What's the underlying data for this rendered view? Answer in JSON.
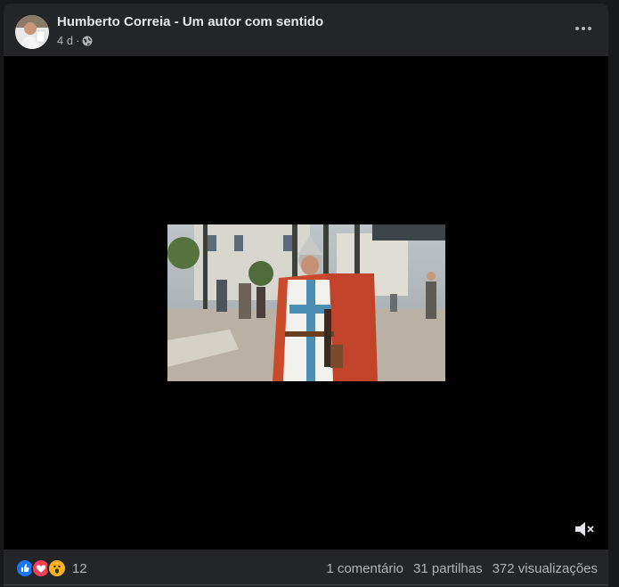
{
  "post": {
    "author": "Humberto Correia - Um autor com sentido",
    "time": "4 d",
    "separator": "·",
    "privacy_icon": "globe-icon"
  },
  "video": {
    "muted": true,
    "mute_icon": "speaker-muted-icon"
  },
  "engagement": {
    "reaction_icons": [
      "like-icon",
      "love-icon",
      "wow-icon"
    ],
    "reaction_count": "12",
    "comments": "1 comentário",
    "shares": "31 partilhas",
    "views": "372 visualizações"
  },
  "colors": {
    "background": "#18191a",
    "card": "#242526",
    "text_primary": "#e4e6eb",
    "text_secondary": "#b0b3b8",
    "like": "#1877f2",
    "love": "#f33e58",
    "wow": "#f7b125"
  }
}
